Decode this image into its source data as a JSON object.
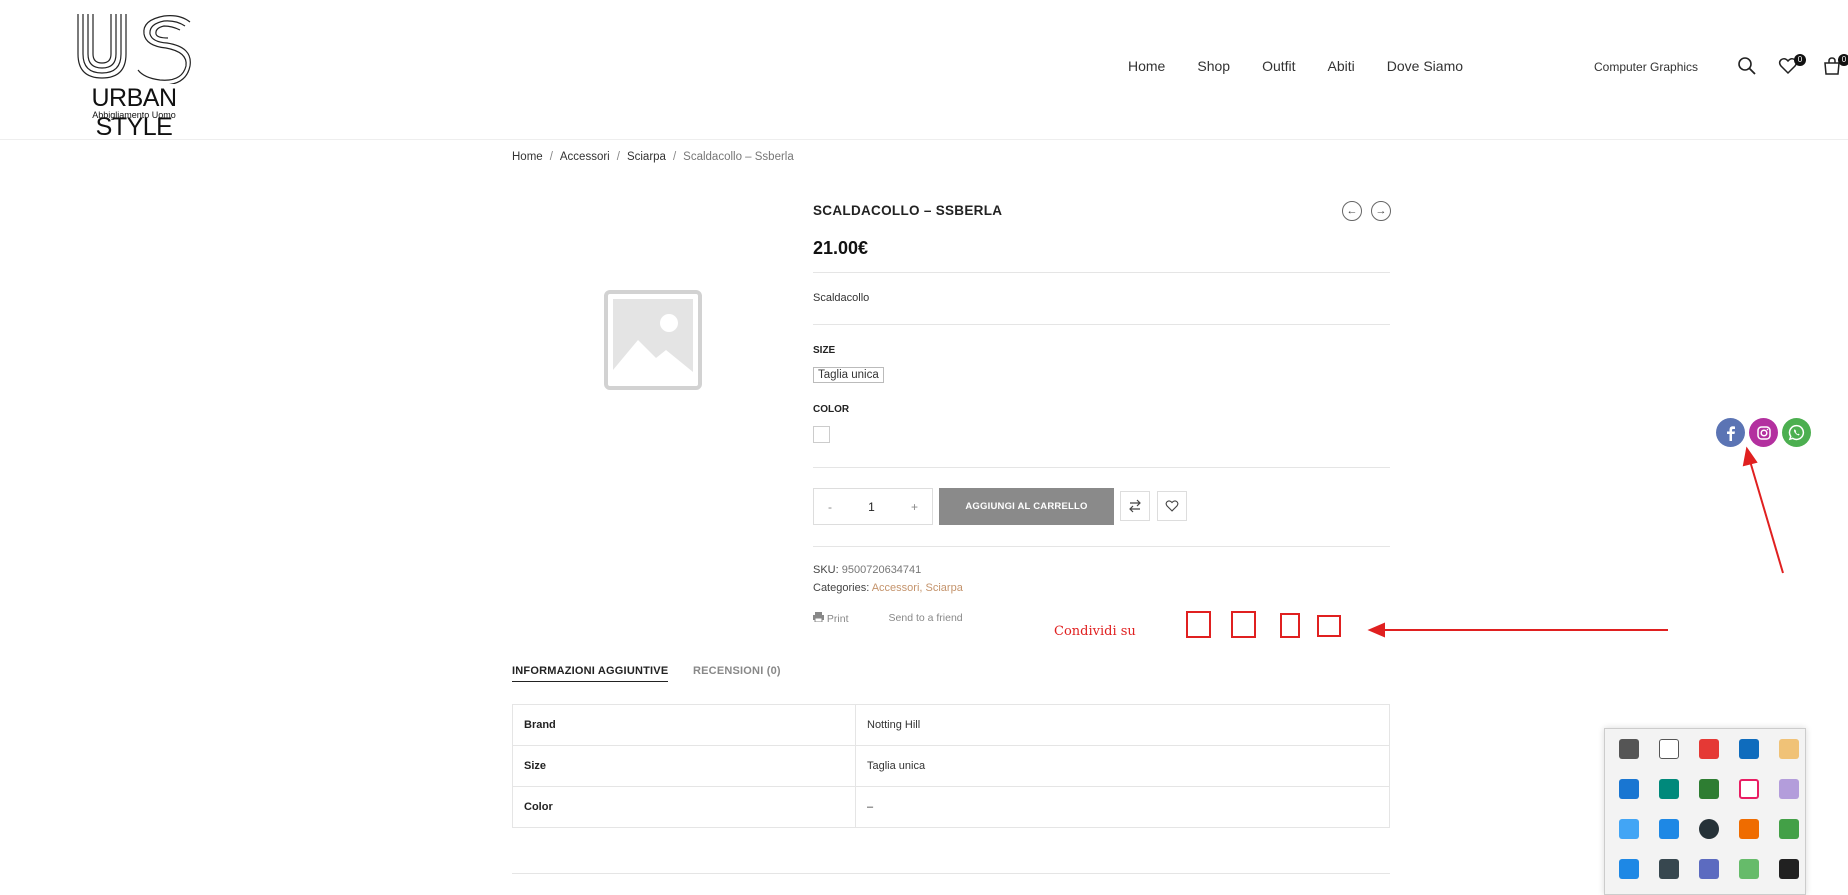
{
  "header": {
    "logo_text": "URBAN STYLE",
    "logo_subtitle": "Abbigliamento Uomo",
    "nav": [
      "Home",
      "Shop",
      "Outfit",
      "Abiti",
      "Dove Siamo"
    ],
    "account_label": "Computer Graphics",
    "wishlist_count": "0",
    "cart_count": "0"
  },
  "breadcrumb": [
    "Home",
    "Accessori",
    "Sciarpa",
    "Scaldacollo – Ssberla"
  ],
  "product": {
    "title": "SCALDACOLLO – SSBERLA",
    "price": "21.00€",
    "short_description": "Scaldacollo",
    "size_label": "SIZE",
    "size_option": "Taglia unica",
    "color_label": "COLOR",
    "qty_minus": "-",
    "qty_value": "1",
    "qty_plus": "+",
    "add_to_cart": "AGGIUNGI AL CARRELLO",
    "sku_label": "SKU:",
    "sku": "9500720634741",
    "categories_label": "Categories:",
    "category_1": "Accessori",
    "category_2": "Sciarpa",
    "print_label": "Print",
    "send_label": "Send to a friend"
  },
  "annotation": {
    "share_label": "Condividi su",
    "red_color": "#e02020"
  },
  "tabs": {
    "info": "INFORMAZIONI AGGIUNTIVE",
    "reviews": "RECENSIONI (0)"
  },
  "attributes": [
    {
      "key": "Brand",
      "value": "Notting Hill"
    },
    {
      "key": "Size",
      "value": "Taglia unica"
    },
    {
      "key": "Color",
      "value": "–"
    }
  ],
  "social": [
    "facebook-icon",
    "instagram-icon",
    "whatsapp-icon"
  ],
  "colors": {
    "accent_link": "#c4936b",
    "cart_button": "#8a8a8a",
    "facebook": "#5b74b4",
    "instagram": "#b3309f",
    "whatsapp": "#4caf50"
  }
}
